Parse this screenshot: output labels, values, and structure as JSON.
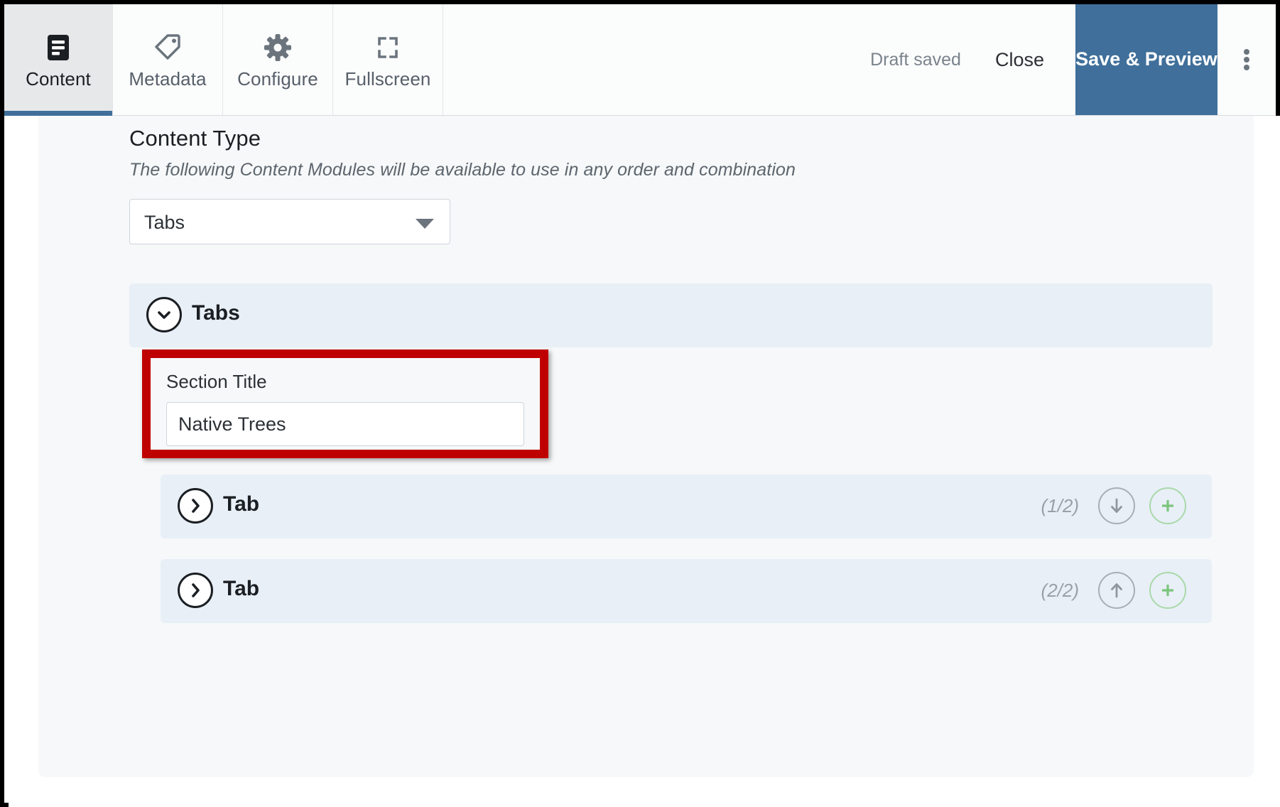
{
  "toolbar": {
    "tabs": [
      {
        "label": "Content",
        "icon": "document-lines-icon",
        "active": true
      },
      {
        "label": "Metadata",
        "icon": "tag-icon",
        "active": false
      },
      {
        "label": "Configure",
        "icon": "gear-icon",
        "active": false
      },
      {
        "label": "Fullscreen",
        "icon": "fullscreen-icon",
        "active": false
      }
    ],
    "draft_status": "Draft saved",
    "close_label": "Close",
    "save_preview_label": "Save & Preview",
    "overflow_icon": "kebab-menu-icon",
    "accent_color": "#3f6f9a",
    "active_tab_bg": "#e6e8e9"
  },
  "main": {
    "page_title": "Content Type",
    "page_subtitle": "The following Content Modules will be available to use in any order and combination",
    "content_type_select": {
      "value": "Tabs",
      "caret_icon": "chevron-down-icon"
    },
    "module": {
      "title": "Tabs",
      "toggle_icon": "circle-chevron-down-icon",
      "header_bg": "#e8eff7",
      "section_title": {
        "label": "Section Title",
        "value": "Native Trees",
        "placeholder": "",
        "highlight_color": "#bf0000"
      },
      "rows": [
        {
          "label": "Tab",
          "counter": "(1/2)",
          "toggle_icon": "circle-chevron-right-icon",
          "move_icon": "circle-arrow-down-icon",
          "add_icon": "circle-plus-icon"
        },
        {
          "label": "Tab",
          "counter": "(2/2)",
          "toggle_icon": "circle-chevron-right-icon",
          "move_icon": "circle-arrow-up-icon",
          "add_icon": "circle-plus-icon"
        }
      ]
    },
    "panel_bg": "#f6f8f9",
    "row_bg": "#e8eff7"
  }
}
